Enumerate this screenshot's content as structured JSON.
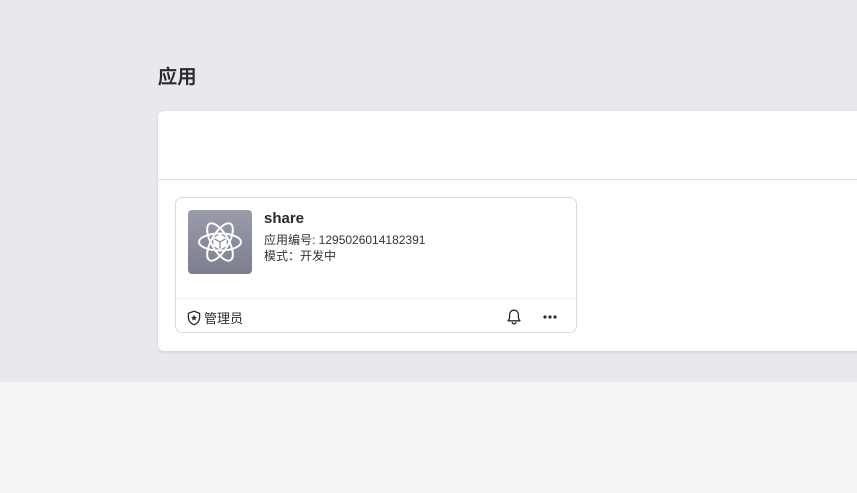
{
  "page": {
    "title": "应用"
  },
  "app_card": {
    "name": "share",
    "id_label": "应用编号: 1295026014182391",
    "mode_label": "模式：开发中",
    "role_label": "管理员",
    "icon": "atom-cube-icon",
    "icon_bg": "#8a8c9c"
  },
  "actions": {
    "notify_icon": "bell-icon",
    "more_icon": "more-dots-icon"
  },
  "colors": {
    "page_bg": "#e8e9ed",
    "lower_bg": "#f5f5f5",
    "card_border": "#d9d9de"
  }
}
